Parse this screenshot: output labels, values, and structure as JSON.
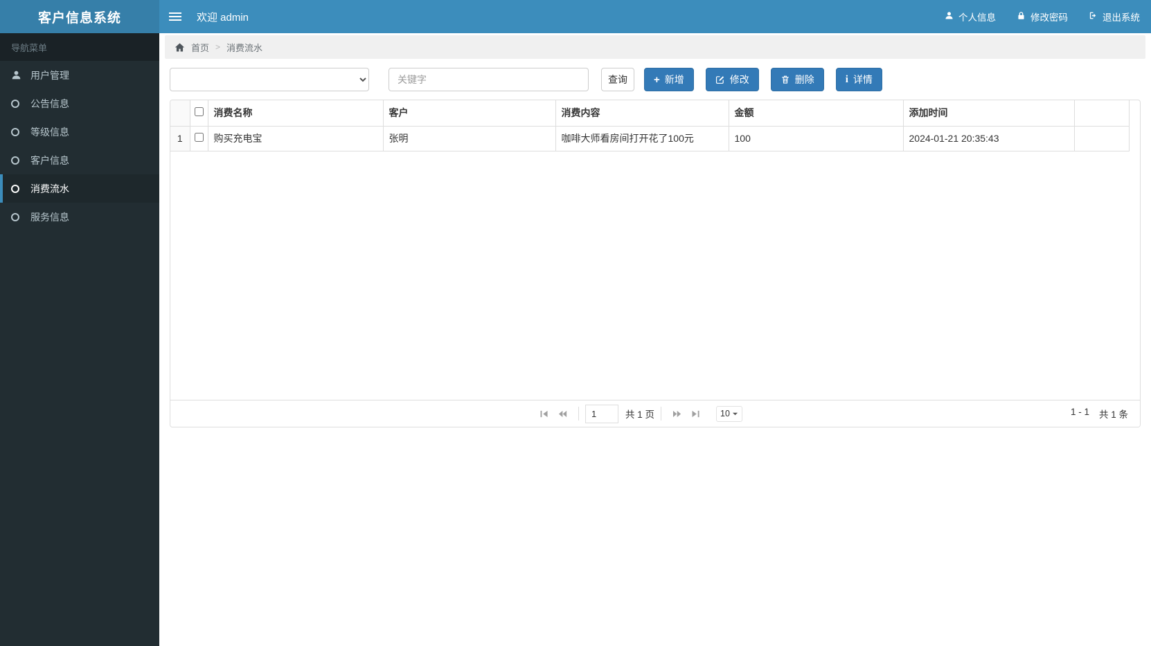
{
  "app": {
    "title": "客户信息系统"
  },
  "colors": {
    "navbar_bg": "#3c8dbc",
    "logo_bg": "#367fa9",
    "sidebar_bg": "#222d32",
    "sidebar_header_bg": "#1a2226",
    "sidebar_active_bg": "#1e282c",
    "sidebar_text": "#b8c7ce",
    "primary": "#337ab7",
    "primary_border": "#2e6da4",
    "breadcrumb_bg": "#f0f0f0",
    "border": "#dddddd"
  },
  "navbar": {
    "welcome": "欢迎 admin",
    "links": [
      {
        "label": "个人信息",
        "icon": "user-icon"
      },
      {
        "label": "修改密码",
        "icon": "lock-icon"
      },
      {
        "label": "退出系统",
        "icon": "sign-out-icon"
      }
    ]
  },
  "sidebar": {
    "header": "导航菜单",
    "items": [
      {
        "label": "用户管理",
        "icon": "user-icon",
        "active": false
      },
      {
        "label": "公告信息",
        "icon": "circle-icon",
        "active": false
      },
      {
        "label": "等级信息",
        "icon": "circle-icon",
        "active": false
      },
      {
        "label": "客户信息",
        "icon": "circle-icon",
        "active": false
      },
      {
        "label": "消费流水",
        "icon": "circle-icon",
        "active": true
      },
      {
        "label": "服务信息",
        "icon": "circle-icon",
        "active": false
      }
    ]
  },
  "breadcrumb": {
    "home": "首页",
    "current": "消费流水"
  },
  "toolbar": {
    "keyword_placeholder": "关键字",
    "search_label": "查询",
    "add_label": "新增",
    "edit_label": "修改",
    "delete_label": "删除",
    "detail_label": "详情"
  },
  "table": {
    "columns": [
      "消费名称",
      "客户",
      "消费内容",
      "金额",
      "添加时间"
    ],
    "rows": [
      {
        "index": "1",
        "name": "购买充电宝",
        "customer": "张明",
        "content": "咖啡大师看房间打开花了100元",
        "amount": "100",
        "time": "2024-01-21 20:35:43"
      }
    ]
  },
  "pagination": {
    "page_value": "1",
    "total_pages": "共 1 页",
    "page_size": "10",
    "summary_range": "1 - 1",
    "summary_total": "共 1 条"
  }
}
